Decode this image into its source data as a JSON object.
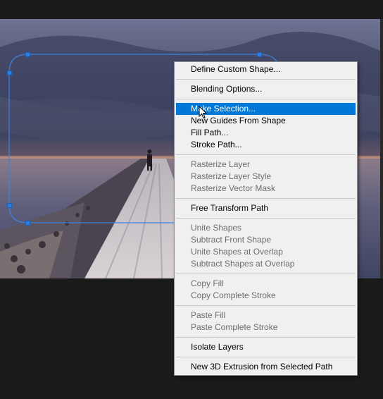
{
  "colors": {
    "menu_bg": "#f0f0f0",
    "highlight": "#0078d7",
    "path_stroke": "#2f7fe0",
    "workspace_bg": "#1a1a1a"
  },
  "context_menu": {
    "groups": [
      [
        {
          "label": "Define Custom Shape...",
          "enabled": true
        }
      ],
      [
        {
          "label": "Blending Options...",
          "enabled": true
        }
      ],
      [
        {
          "label": "Make Selection...",
          "enabled": true,
          "highlighted": true
        },
        {
          "label": "New Guides From Shape",
          "enabled": true
        },
        {
          "label": "Fill Path...",
          "enabled": true
        },
        {
          "label": "Stroke Path...",
          "enabled": true
        }
      ],
      [
        {
          "label": "Rasterize Layer",
          "enabled": false
        },
        {
          "label": "Rasterize Layer Style",
          "enabled": false
        },
        {
          "label": "Rasterize Vector Mask",
          "enabled": false
        }
      ],
      [
        {
          "label": "Free Transform Path",
          "enabled": true
        }
      ],
      [
        {
          "label": "Unite Shapes",
          "enabled": false
        },
        {
          "label": "Subtract Front Shape",
          "enabled": false
        },
        {
          "label": "Unite Shapes at Overlap",
          "enabled": false
        },
        {
          "label": "Subtract Shapes at Overlap",
          "enabled": false
        }
      ],
      [
        {
          "label": "Copy Fill",
          "enabled": false
        },
        {
          "label": "Copy Complete Stroke",
          "enabled": false
        }
      ],
      [
        {
          "label": "Paste Fill",
          "enabled": false
        },
        {
          "label": "Paste Complete Stroke",
          "enabled": false
        }
      ],
      [
        {
          "label": "Isolate Layers",
          "enabled": true
        }
      ],
      [
        {
          "label": "New 3D Extrusion from Selected Path",
          "enabled": true
        }
      ]
    ]
  },
  "icons": {
    "cursor": "arrow-cursor-icon"
  }
}
